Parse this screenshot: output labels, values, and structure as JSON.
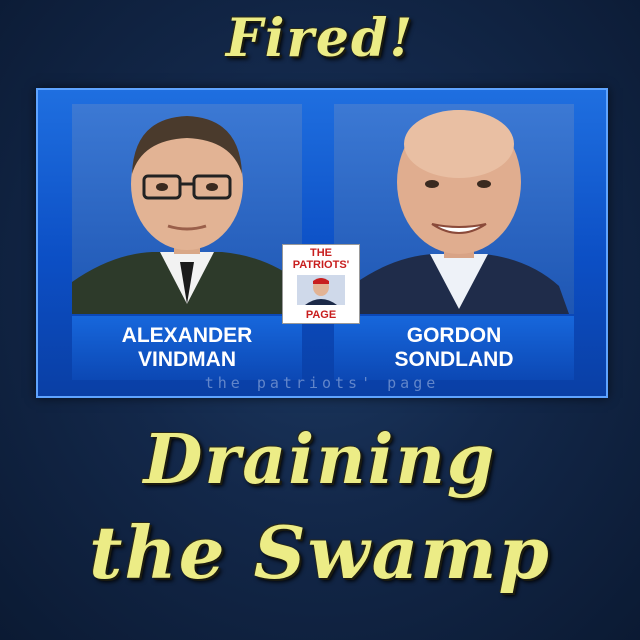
{
  "headline_top": "Fired!",
  "headline_bottom_line1": "Draining",
  "headline_bottom_line2": "the Swamp",
  "left_person": {
    "name_line1": "ALEXANDER",
    "name_line2": "VINDMAN"
  },
  "right_person": {
    "name_line1": "GORDON",
    "name_line2": "SONDLAND"
  },
  "watermark": "the patriots' page",
  "logo": {
    "line1": "THE",
    "line2": "PATRIOTS'",
    "line3": "PAGE"
  },
  "colors": {
    "headline": "#ecec86",
    "panel_blue": "#0c4fc5",
    "background": "#13284a"
  }
}
